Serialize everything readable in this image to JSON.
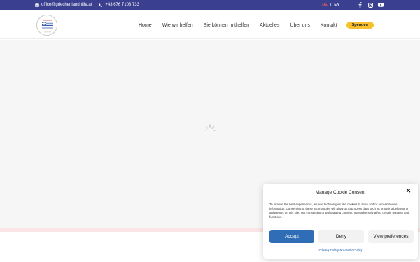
{
  "topbar": {
    "email": "office@griechenlandhilfe.at",
    "phone": "+43 676 7103 733",
    "lang_de": "DE",
    "lang_sep": "/",
    "lang_en": "EN",
    "socials": [
      "facebook-icon",
      "instagram-icon",
      "youtube-icon"
    ],
    "background": "#3a3f8f"
  },
  "nav": {
    "items": [
      "Home",
      "Wie wir helfen",
      "Sie können mithelfen",
      "Aktuelles",
      "Über uns",
      "Kontakt"
    ],
    "active": "Home",
    "donate": "Spenden",
    "donate_color": "#f6c12d"
  },
  "cookie": {
    "title": "Manage Cookie Consent",
    "body": "To provide the best experiences, we use technologies like cookies to store and/or access device information. Consenting to these technologies will allow us to process data such as browsing behavior or unique IDs on this site. Not consenting or withdrawing consent, may adversely affect certain features and functions.",
    "accept": "Accept",
    "deny": "Deny",
    "preferences": "View preferences",
    "links": "Privacy Policy & Cookie Policy",
    "accent": "#2f6db6"
  }
}
